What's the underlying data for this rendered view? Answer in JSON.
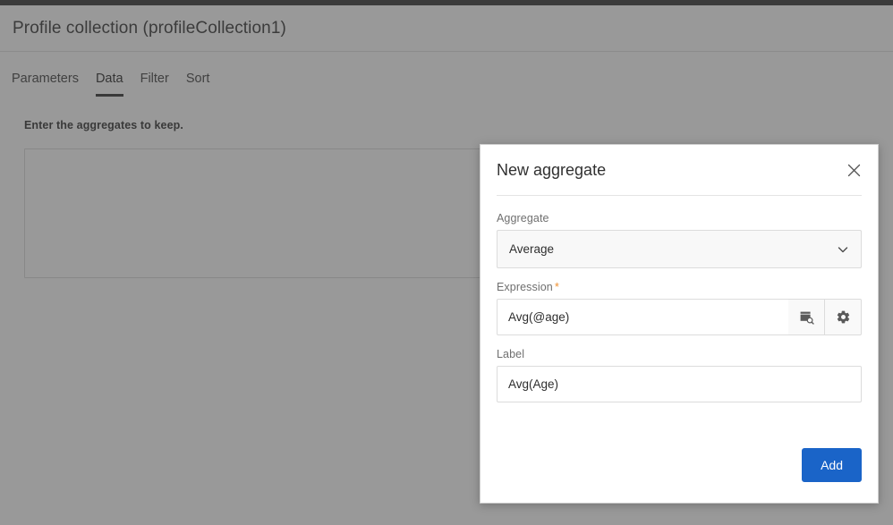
{
  "window": {
    "title": "Profile collection (profileCollection1)"
  },
  "tabs": [
    {
      "label": "Parameters",
      "active": false
    },
    {
      "label": "Data",
      "active": true
    },
    {
      "label": "Filter",
      "active": false
    },
    {
      "label": "Sort",
      "active": false
    }
  ],
  "content": {
    "hint": "Enter the aggregates to keep.",
    "aggregates_list": []
  },
  "dialog": {
    "title": "New aggregate",
    "close_icon": "close-icon",
    "fields": {
      "aggregate": {
        "label": "Aggregate",
        "value": "Average",
        "chevron_icon": "chevron-down-icon",
        "required": false
      },
      "expression": {
        "label": "Expression",
        "required": true,
        "required_marker": "*",
        "value": "Avg(@age)",
        "placeholder": "",
        "buttons": [
          {
            "name": "browse-data-icon"
          },
          {
            "name": "gear-icon"
          }
        ]
      },
      "label": {
        "label": "Label",
        "value": "Avg(Age)",
        "placeholder": "",
        "required": false
      }
    },
    "actions": {
      "add_label": "Add"
    }
  },
  "colors": {
    "primary": "#1a64c8",
    "required": "#ef9133",
    "scrim": "#454545",
    "tab_active_underline": "#2b2b2b",
    "top_strip": "#3b3b3b"
  }
}
